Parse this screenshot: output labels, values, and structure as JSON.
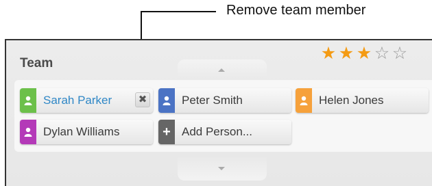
{
  "callout": {
    "text": "Remove team member"
  },
  "panel": {
    "title": "Team",
    "rating": {
      "value": 3,
      "max": 5,
      "filled_color": "#f49b14",
      "empty_color": "#9a9a9a"
    },
    "scroll_up_icon": "chevron-up-icon",
    "scroll_down_icon": "chevron-down-icon"
  },
  "members": [
    {
      "name": "Sarah Parker",
      "color": "#6cc04a",
      "icon": "person-icon",
      "active": true,
      "remove_glyph": "✖"
    },
    {
      "name": "Peter Smith",
      "color": "#4b73c4",
      "icon": "person-icon",
      "active": false
    },
    {
      "name": "Helen Jones",
      "color": "#f6a13b",
      "icon": "person-icon",
      "active": false
    },
    {
      "name": "Dylan Williams",
      "color": "#b43ab8",
      "icon": "person-icon",
      "active": false
    }
  ],
  "add_person": {
    "label": "Add Person...",
    "color": "#666666",
    "glyph": "+",
    "icon": "plus-icon"
  }
}
